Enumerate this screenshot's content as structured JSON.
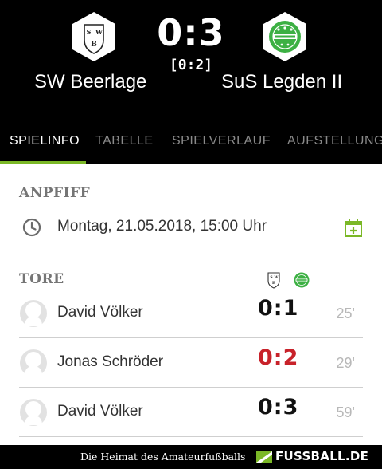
{
  "match": {
    "score": "0:3",
    "halftime": "[0:2]",
    "home": {
      "name": "SW Beerlage",
      "logo_letters": [
        "S",
        "W",
        "B"
      ],
      "icon": "sw-beerlage-crest-icon"
    },
    "away": {
      "name": "SuS Legden II",
      "logo_color": "#3cb043",
      "icon": "sus-legden-crest-icon"
    }
  },
  "tabs": [
    {
      "label": "SPIELINFO",
      "active": true
    },
    {
      "label": "TABELLE",
      "active": false
    },
    {
      "label": "SPIELVERLAUF",
      "active": false
    },
    {
      "label": "AUFSTELLUNG",
      "active": false
    }
  ],
  "anpfiff": {
    "title": "ANPFIFF",
    "datetime": "Montag, 21.05.2018, 15:00 Uhr",
    "icons": [
      "clock-icon",
      "calendar-add-icon"
    ]
  },
  "tore": {
    "title": "TORE",
    "goals": [
      {
        "scorer": "David Völker",
        "score": "0:1",
        "minute": "25'",
        "highlight": false
      },
      {
        "scorer": "Jonas Schröder",
        "score": "0:2",
        "minute": "29'",
        "highlight": true
      },
      {
        "scorer": "David Völker",
        "score": "0:3",
        "minute": "59'",
        "highlight": false
      }
    ]
  },
  "footer": {
    "tagline": "Die Heimat des Amateurfußballs",
    "brand": "FUSSBALL.DE"
  },
  "colors": {
    "accent_green": "#7bb827",
    "highlight_red": "#c8222a",
    "header_bg": "#000000"
  }
}
